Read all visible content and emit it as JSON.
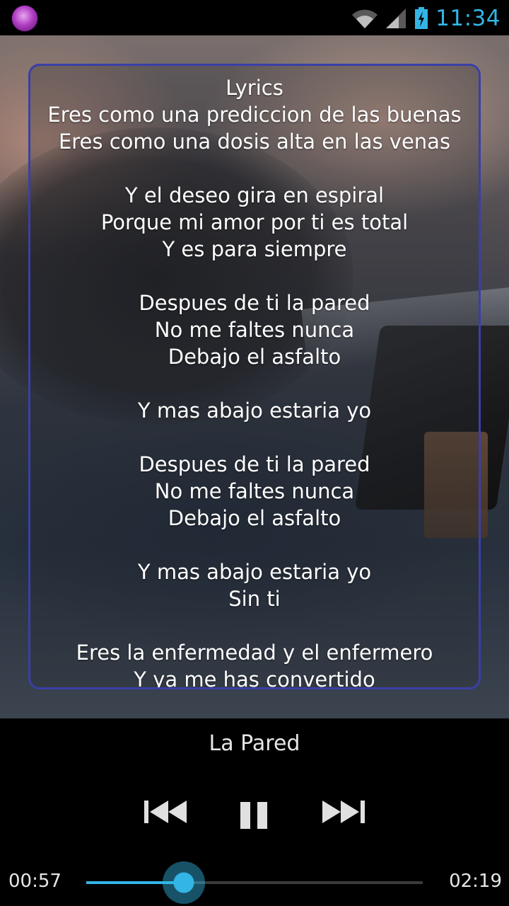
{
  "status_bar": {
    "time": "11:34",
    "icons": [
      "app-icon",
      "wifi-icon",
      "signal-icon",
      "battery-charging-icon"
    ]
  },
  "lyrics": {
    "lines": [
      "Lyrics",
      "Eres como una prediccion de las buenas",
      "Eres como una dosis alta en las venas",
      "",
      "Y el deseo gira en espiral",
      "Porque mi amor por ti es total",
      "Y es para siempre",
      "",
      "Despues de ti la pared",
      "No me faltes nunca",
      "Debajo el asfalto",
      "",
      "Y mas abajo estaria yo",
      "",
      "Despues de ti la pared",
      "No me faltes nunca",
      "Debajo el asfalto",
      "",
      "Y mas abajo estaria yo",
      "Sin ti",
      "",
      "Eres la enfermedad y el enfermero",
      "Y ya me has convertido"
    ]
  },
  "player": {
    "title": "La Pared",
    "current_time": "00:57",
    "total_time": "02:19",
    "progress": 0.29,
    "controls": [
      "previous-icon",
      "pause-icon",
      "next-icon"
    ],
    "accent_color": "#33b5e5",
    "panel_border_color": "#3a3fa8"
  }
}
